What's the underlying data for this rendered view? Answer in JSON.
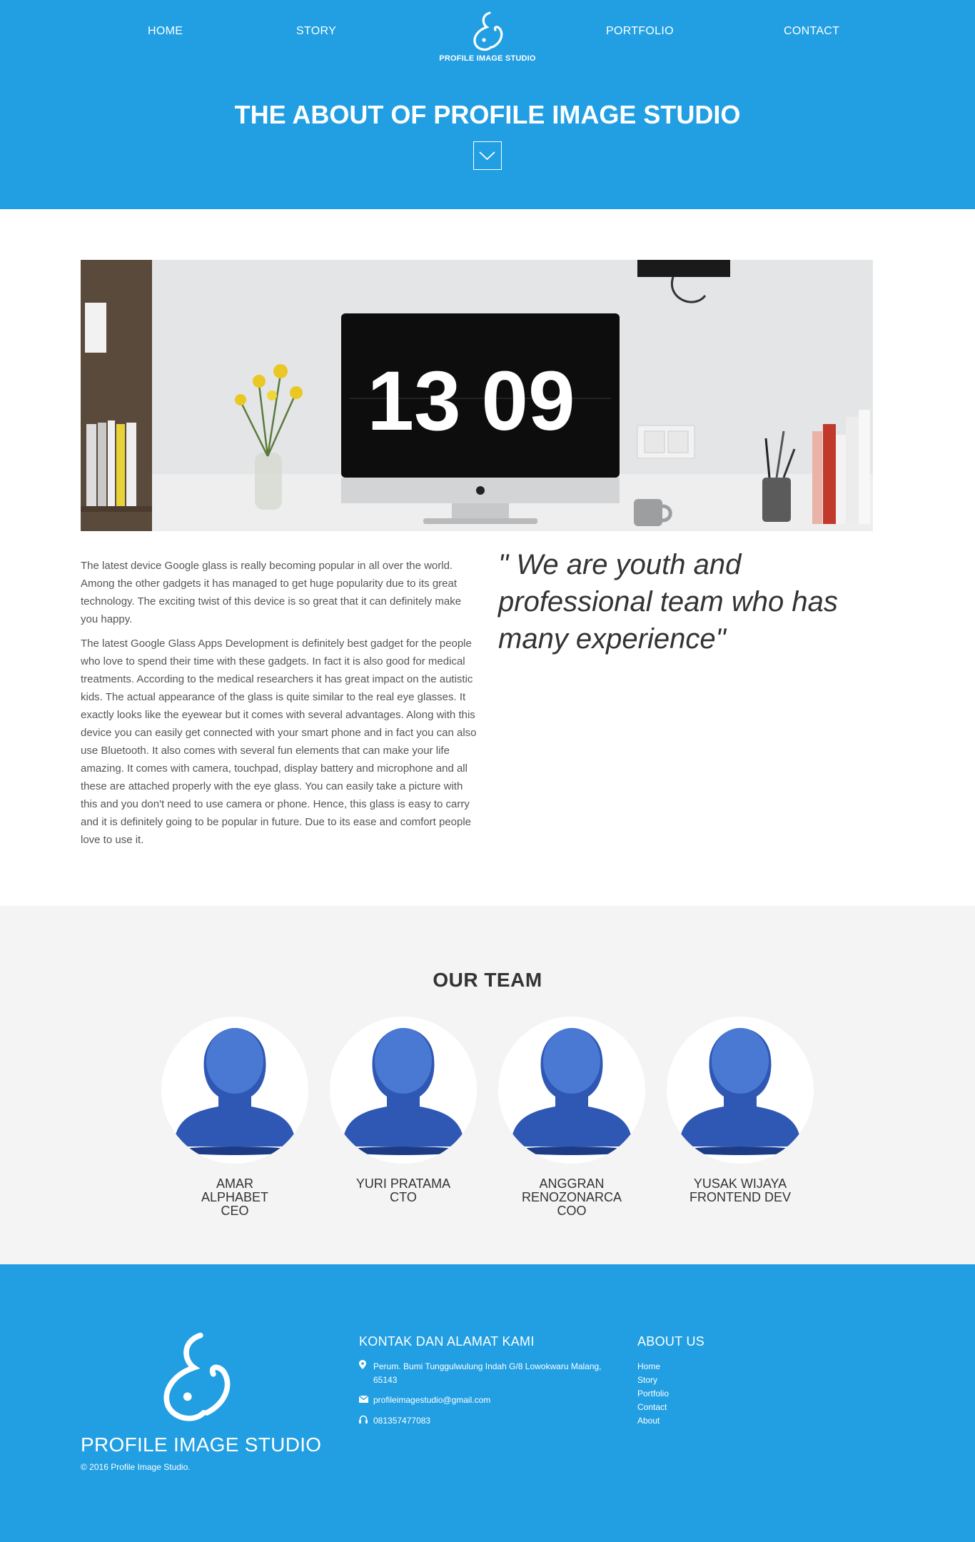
{
  "nav": {
    "home": "HOME",
    "story": "STORY",
    "portfolio": "PORTFOLIO",
    "contact": "CONTACT"
  },
  "brand": {
    "name": "PROFILE IMAGE STUDIO",
    "logo_icon": "profile-image-studio-logo"
  },
  "hero": {
    "title_pre": "THE ",
    "title_bold": "ABOUT",
    "title_post": " OF PROFILE IMAGE STUDIO",
    "scroll_icon": "chevron-down-icon"
  },
  "about": {
    "image_clock_hours": "13",
    "image_clock_minutes": "09",
    "paragraph_1": "The latest device Google glass is really becoming popular in all over the world. Among the other gadgets it has managed to get huge popularity due to its great technology. The exciting twist of this device is so great that it can definitely make you happy.",
    "paragraph_2": "The latest Google Glass Apps Development is definitely best gadget for the people who love to spend their time with these gadgets. In fact it is also good for medical treatments. According to the medical researchers it has great impact on the autistic kids. The actual appearance of the glass is quite similar to the real eye glasses. It exactly looks like the eyewear but it comes with several advantages. Along with this device you can easily get connected with your smart phone and in fact you can also use Bluetooth. It also comes with several fun elements that can make your life amazing. It comes with camera, touchpad, display battery and microphone and all these are attached properly with the eye glass. You can easily take a picture with this and you don't need to use camera or phone. Hence, this glass is easy to carry and it is definitely going to be popular in future. Due to its ease and comfort people love to use it.",
    "quote": "\" We are youth and professional team who has many experience\""
  },
  "team": {
    "title": "OUR TEAM",
    "members": [
      {
        "name": "AMAR ALPHABET",
        "role": "CEO"
      },
      {
        "name": "YURI PRATAMA",
        "role": "CTO"
      },
      {
        "name": "ANGGRAN RENOZONARCA",
        "role": "COO"
      },
      {
        "name": "YUSAK WIJAYA",
        "role": "FRONTEND DEV"
      }
    ]
  },
  "footer": {
    "brand_name": "PROFILE IMAGE STUDIO",
    "copyright": "© 2016 Profile Image Studio.",
    "contact_title": "KONTAK DAN ALAMAT KAMI",
    "address": "Perum. Bumi Tunggulwulung Indah G/8 Lowokwaru Malang, 65143",
    "email": "profileimagestudio@gmail.com",
    "phone": "081357477083",
    "about_title": "ABOUT US",
    "links": [
      "Home",
      "Story",
      "Portfolio",
      "Contact",
      "About"
    ]
  },
  "colors": {
    "primary": "#219fe2",
    "team_bg": "#f4f4f4",
    "avatar_blue": "#2f58b4"
  }
}
